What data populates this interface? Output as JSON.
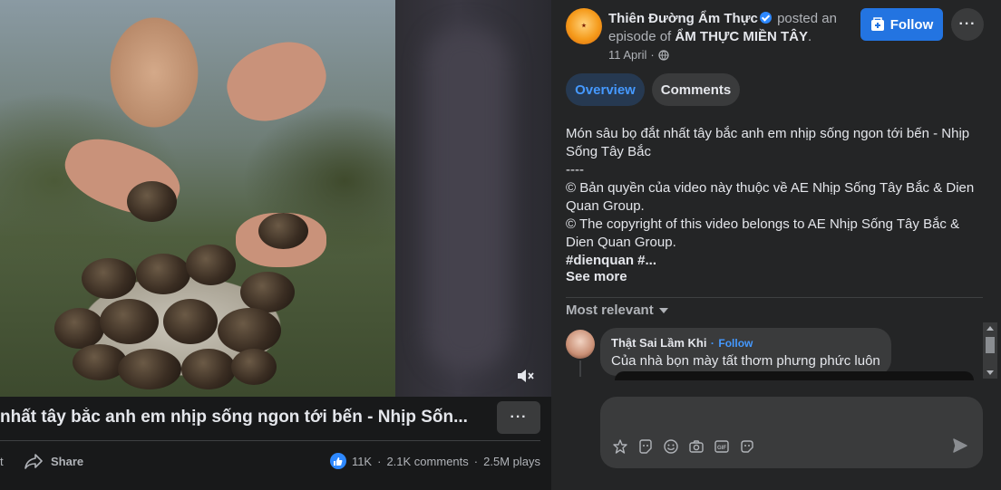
{
  "video": {
    "title": "nhất tây bắc anh em nhịp sống ngon tới bến - Nhịp Sốn...",
    "title_more_label": "···",
    "cut_label": "t",
    "share_label": "Share",
    "likes": "11K",
    "comments": "2.1K comments",
    "plays": "2.5M plays",
    "separator": "·"
  },
  "post": {
    "page_name": "Thiên Đường Ẩm Thực",
    "posted_text": "posted an episode of",
    "show_name": "ẨM THỰC MIỀN TÂY",
    "period": ".",
    "date": "11 April",
    "date_sep": "·",
    "follow_label": "Follow",
    "more_label": "···"
  },
  "tabs": [
    {
      "label": "Overview"
    },
    {
      "label": "Comments"
    }
  ],
  "description": {
    "line1": "Món sâu bọ đắt nhất tây bắc anh em nhịp sống ngon tới bến - Nhịp Sống Tây Bắc",
    "line2": "----",
    "line3": "© Bản quyền của video này thuộc về AE Nhịp Sống Tây Bắc & Dien Quan Group.",
    "line4": "© The copyright of this video belongs to AE Nhịp Sống Tây Bắc & Dien Quan Group.",
    "hashtags": "#dienquan #...",
    "see_more": "See more"
  },
  "comments_section": {
    "sort_label": "Most relevant",
    "items": [
      {
        "author": "Thật Sai Lầm Khi",
        "follow": "Follow",
        "dot": "·",
        "text": "Của nhà bọn mày tất thơm phưng phức luôn"
      }
    ],
    "composer_placeholder": ""
  },
  "colors": {
    "accent": "#2374e1",
    "link": "#4599ff",
    "panel": "#242526",
    "background": "#18191a"
  }
}
